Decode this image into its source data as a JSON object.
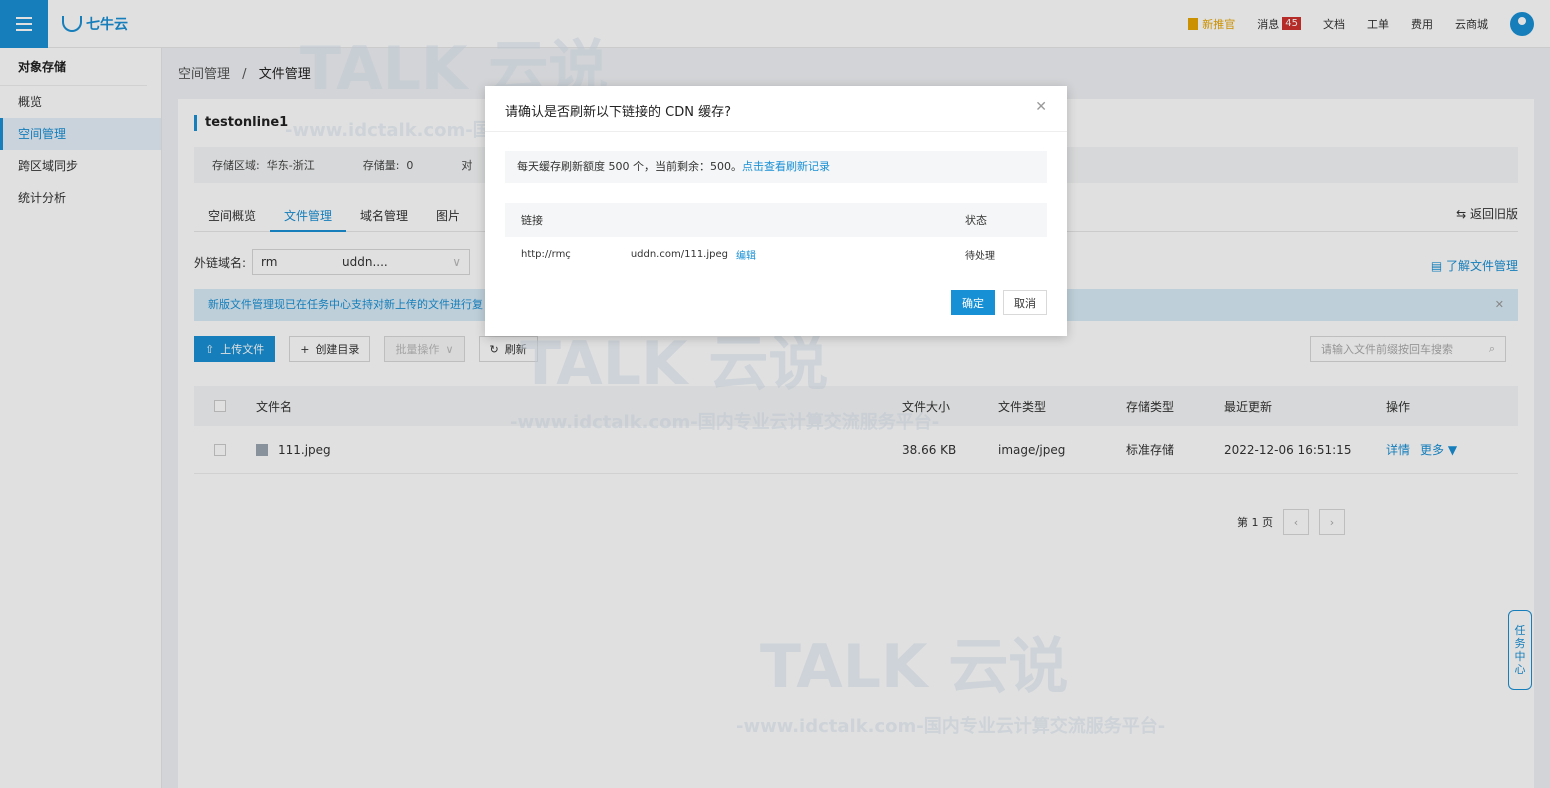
{
  "topbar": {
    "logo_text": "七牛云",
    "new_label": "新推官",
    "messages_label": "消息",
    "messages_count": "45",
    "docs_label": "文档",
    "tickets_label": "工单",
    "billing_label": "费用",
    "market_label": "云商城"
  },
  "sidebar": {
    "title": "对象存储",
    "items": [
      {
        "label": "概览"
      },
      {
        "label": "空间管理"
      },
      {
        "label": "跨区域同步"
      },
      {
        "label": "统计分析"
      }
    ]
  },
  "breadcrumb": {
    "parent": "空间管理",
    "separator": "/",
    "current": "文件管理"
  },
  "bucket": {
    "name": "testonline1",
    "region_label": "存储区域:",
    "region_value": "华东-浙江",
    "usage_label": "存储量:",
    "usage_value": "0",
    "extra_label": "对"
  },
  "tabs": [
    "空间概览",
    "文件管理",
    "域名管理",
    "图片"
  ],
  "old_version_label": "⇆ 返回旧版",
  "domain": {
    "label": "外链域名:",
    "value_start": "rm",
    "value_end": "uddn....",
    "learn_link": "了解文件管理"
  },
  "notice": {
    "text": "新版文件管理现已在任务中心支持对新上传的文件进行复"
  },
  "toolbar": {
    "upload": "上传文件",
    "mkdir": "创建目录",
    "batch": "批量操作",
    "refresh": "刷新",
    "search_placeholder": "请输入文件前缀按回车搜索"
  },
  "table": {
    "headers": {
      "name": "文件名",
      "size": "文件大小",
      "type": "文件类型",
      "storage": "存储类型",
      "updated": "最近更新",
      "actions": "操作"
    },
    "rows": [
      {
        "name": "111.jpeg",
        "size": "38.66 KB",
        "type": "image/jpeg",
        "storage": "标准存储",
        "updated": "2022-12-06 16:51:15",
        "detail": "详情",
        "more": "更多 ▼"
      }
    ]
  },
  "pager": {
    "page_label": "第 1 页"
  },
  "task_center": {
    "label_chars": [
      "任",
      "务",
      "中",
      "心"
    ]
  },
  "modal": {
    "title": "请确认是否刷新以下链接的 CDN 缓存?",
    "quota_text": "每天缓存刷新额度 500 个，当前剩余：500。",
    "quota_link": "点击查看刷新记录",
    "col_link": "链接",
    "col_status": "状态",
    "row_url_start": "http://rmç",
    "row_url_end": "uddn.com/111.jpeg",
    "row_edit": "编辑",
    "row_status": "待处理",
    "confirm": "确定",
    "cancel": "取消"
  },
  "watermark": {
    "brand": "TALK 云说",
    "tagline": "-www.idctalk.com-国内专业云计算交流服务平台-"
  },
  "colors": {
    "accent": "#1890d5",
    "badge_red": "#d0312d",
    "new_orange": "#e8a500"
  }
}
